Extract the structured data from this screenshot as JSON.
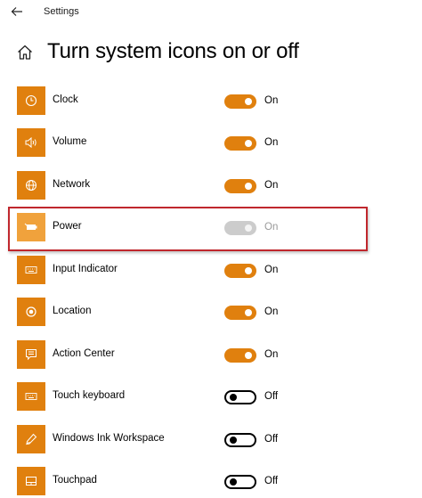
{
  "app": {
    "title": "Settings"
  },
  "header": {
    "title": "Turn system icons on or off"
  },
  "colors": {
    "accent": "#e0800e",
    "highlight_border": "#c0272d",
    "disabled": "#cccccc"
  },
  "items": [
    {
      "label": "Clock",
      "state": "On",
      "enabled": true,
      "icon": "clock-icon"
    },
    {
      "label": "Volume",
      "state": "On",
      "enabled": true,
      "icon": "volume-icon"
    },
    {
      "label": "Network",
      "state": "On",
      "enabled": true,
      "icon": "network-globe-icon"
    },
    {
      "label": "Power",
      "state": "On",
      "enabled": false,
      "icon": "battery-icon"
    },
    {
      "label": "Input Indicator",
      "state": "On",
      "enabled": true,
      "icon": "keyboard-icon"
    },
    {
      "label": "Location",
      "state": "On",
      "enabled": true,
      "icon": "location-icon"
    },
    {
      "label": "Action Center",
      "state": "On",
      "enabled": true,
      "icon": "action-center-icon"
    },
    {
      "label": "Touch keyboard",
      "state": "Off",
      "enabled": true,
      "icon": "keyboard-icon"
    },
    {
      "label": "Windows Ink Workspace",
      "state": "Off",
      "enabled": true,
      "icon": "pen-icon"
    },
    {
      "label": "Touchpad",
      "state": "Off",
      "enabled": true,
      "icon": "touchpad-icon"
    }
  ]
}
